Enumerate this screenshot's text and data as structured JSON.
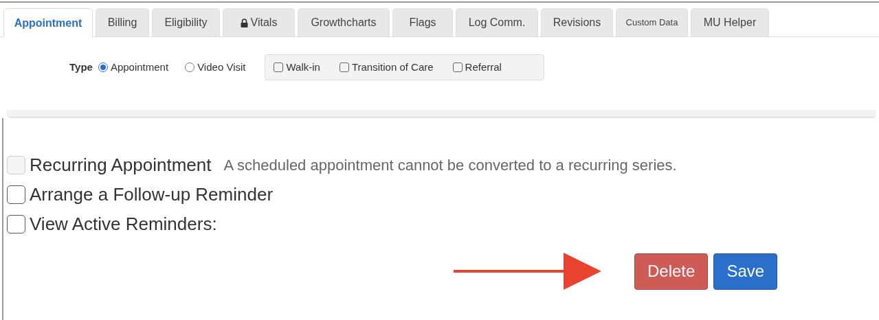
{
  "tabs": [
    {
      "label": "Appointment",
      "selected": true,
      "locked": false
    },
    {
      "label": "Billing",
      "selected": false,
      "locked": false
    },
    {
      "label": "Eligibility",
      "selected": false,
      "locked": false
    },
    {
      "label": "Vitals",
      "selected": false,
      "locked": true
    },
    {
      "label": "Growthcharts",
      "selected": false,
      "locked": false
    },
    {
      "label": "Flags",
      "selected": false,
      "locked": false
    },
    {
      "label": "Log Comm.",
      "selected": false,
      "locked": false
    },
    {
      "label": "Revisions",
      "selected": false,
      "locked": false
    },
    {
      "label": "Custom Data",
      "selected": false,
      "locked": false
    },
    {
      "label": "MU Helper",
      "selected": false,
      "locked": false
    }
  ],
  "type_field": {
    "label": "Type",
    "radios": [
      {
        "label": "Appointment",
        "selected": true
      },
      {
        "label": "Video Visit",
        "selected": false
      }
    ],
    "checkboxes": [
      {
        "label": "Walk-in",
        "checked": false
      },
      {
        "label": "Transition of Care",
        "checked": false
      },
      {
        "label": "Referral",
        "checked": false
      }
    ]
  },
  "options": [
    {
      "label": "Recurring Appointment",
      "checked": false,
      "disabled": true,
      "note": "A scheduled appointment cannot be converted to a recurring series."
    },
    {
      "label": "Arrange a Follow-up Reminder",
      "checked": false,
      "disabled": false
    },
    {
      "label": "View Active Reminders:",
      "checked": false,
      "disabled": false
    }
  ],
  "buttons": [
    {
      "label": "Delete",
      "kind": "danger"
    },
    {
      "label": "Save",
      "kind": "primary"
    }
  ]
}
